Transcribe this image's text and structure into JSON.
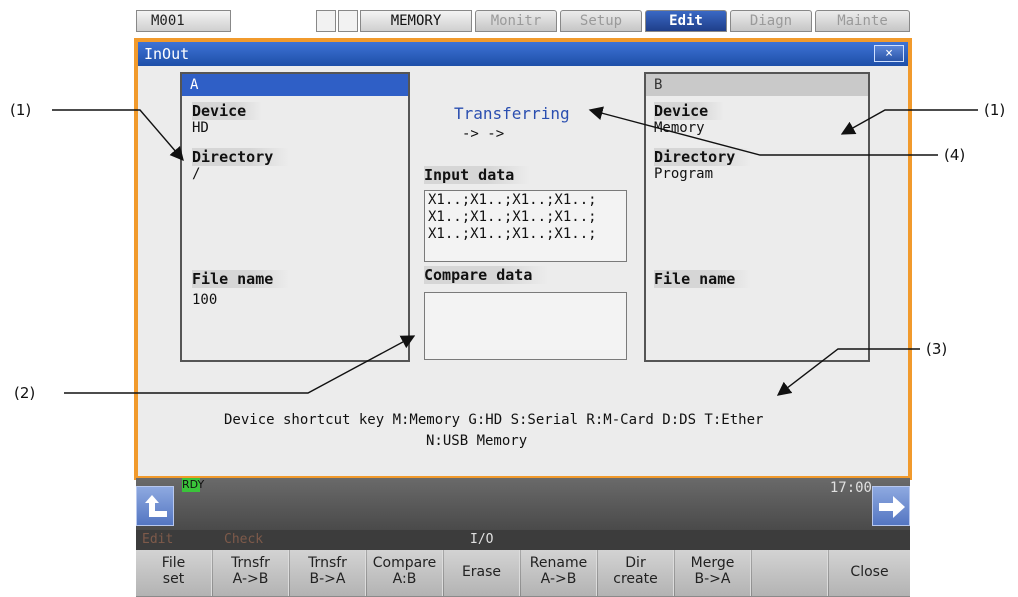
{
  "topbar": {
    "program": "M001",
    "mode": "MEMORY",
    "tabs": [
      "Monitr",
      "Setup",
      "Edit",
      "Diagn",
      "Mainte"
    ],
    "active_tab": "Edit"
  },
  "window": {
    "title": "InOut",
    "close": "×"
  },
  "panel_a": {
    "header": "A",
    "device_label": "Device",
    "device": "HD",
    "directory_label": "Directory",
    "directory": "/",
    "filename_label": "File name",
    "filename": "100"
  },
  "panel_b": {
    "header": "B",
    "device_label": "Device",
    "device": "Memory",
    "directory_label": "Directory",
    "directory": "Program",
    "filename_label": "File name",
    "filename": ""
  },
  "center": {
    "status": "Transferring",
    "arrows": "-> ->",
    "input_label": "Input data",
    "input_lines": "X1..;X1..;X1..;X1..;\nX1..;X1..;X1..;X1..;\nX1..;X1..;X1..;X1..;",
    "compare_label": "Compare data",
    "compare_lines": ""
  },
  "shortcut": {
    "line1": "Device shortcut key M:Memory G:HD S:Serial R:M-Card D:DS T:Ether",
    "line2": "N:USB Memory"
  },
  "status": {
    "rdy": "RDY",
    "time": "17:00"
  },
  "menu_path": {
    "a": "Edit",
    "b": "Check",
    "c": "I/O"
  },
  "fkeys": [
    {
      "l1": "File",
      "l2": "set"
    },
    {
      "l1": "Trnsfr",
      "l2": "A->B"
    },
    {
      "l1": "Trnsfr",
      "l2": "B->A"
    },
    {
      "l1": "Compare",
      "l2": "A:B"
    },
    {
      "l1": "Erase",
      "l2": ""
    },
    {
      "l1": "Rename",
      "l2": "A->B"
    },
    {
      "l1": "Dir",
      "l2": "create"
    },
    {
      "l1": "Merge",
      "l2": "B->A"
    },
    {
      "l1": "",
      "l2": ""
    },
    {
      "l1": "Close",
      "l2": ""
    }
  ],
  "callouts": {
    "c1a": "(1)",
    "c1b": "(1)",
    "c4": "(4)",
    "c3": "(3)",
    "c2": "(2)"
  },
  "colors": {
    "frame": "#f19a2c",
    "title": "#1e4fa8",
    "transfer": "#2b4fb0",
    "rdy": "#3ac43a"
  }
}
